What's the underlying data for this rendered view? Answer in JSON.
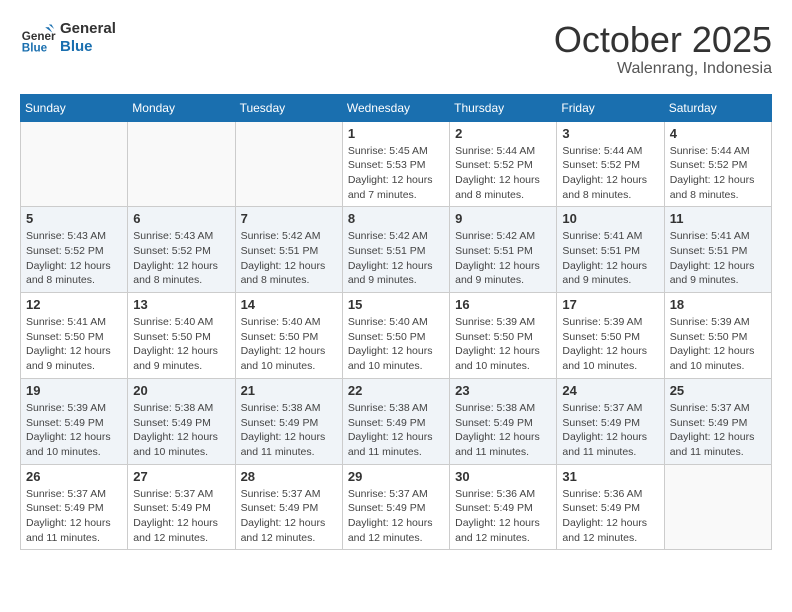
{
  "header": {
    "logo_line1": "General",
    "logo_line2": "Blue",
    "month": "October 2025",
    "location": "Walenrang, Indonesia"
  },
  "days_of_week": [
    "Sunday",
    "Monday",
    "Tuesday",
    "Wednesday",
    "Thursday",
    "Friday",
    "Saturday"
  ],
  "weeks": [
    [
      {
        "day": "",
        "info": ""
      },
      {
        "day": "",
        "info": ""
      },
      {
        "day": "",
        "info": ""
      },
      {
        "day": "1",
        "info": "Sunrise: 5:45 AM\nSunset: 5:53 PM\nDaylight: 12 hours\nand 7 minutes."
      },
      {
        "day": "2",
        "info": "Sunrise: 5:44 AM\nSunset: 5:52 PM\nDaylight: 12 hours\nand 8 minutes."
      },
      {
        "day": "3",
        "info": "Sunrise: 5:44 AM\nSunset: 5:52 PM\nDaylight: 12 hours\nand 8 minutes."
      },
      {
        "day": "4",
        "info": "Sunrise: 5:44 AM\nSunset: 5:52 PM\nDaylight: 12 hours\nand 8 minutes."
      }
    ],
    [
      {
        "day": "5",
        "info": "Sunrise: 5:43 AM\nSunset: 5:52 PM\nDaylight: 12 hours\nand 8 minutes."
      },
      {
        "day": "6",
        "info": "Sunrise: 5:43 AM\nSunset: 5:52 PM\nDaylight: 12 hours\nand 8 minutes."
      },
      {
        "day": "7",
        "info": "Sunrise: 5:42 AM\nSunset: 5:51 PM\nDaylight: 12 hours\nand 8 minutes."
      },
      {
        "day": "8",
        "info": "Sunrise: 5:42 AM\nSunset: 5:51 PM\nDaylight: 12 hours\nand 9 minutes."
      },
      {
        "day": "9",
        "info": "Sunrise: 5:42 AM\nSunset: 5:51 PM\nDaylight: 12 hours\nand 9 minutes."
      },
      {
        "day": "10",
        "info": "Sunrise: 5:41 AM\nSunset: 5:51 PM\nDaylight: 12 hours\nand 9 minutes."
      },
      {
        "day": "11",
        "info": "Sunrise: 5:41 AM\nSunset: 5:51 PM\nDaylight: 12 hours\nand 9 minutes."
      }
    ],
    [
      {
        "day": "12",
        "info": "Sunrise: 5:41 AM\nSunset: 5:50 PM\nDaylight: 12 hours\nand 9 minutes."
      },
      {
        "day": "13",
        "info": "Sunrise: 5:40 AM\nSunset: 5:50 PM\nDaylight: 12 hours\nand 9 minutes."
      },
      {
        "day": "14",
        "info": "Sunrise: 5:40 AM\nSunset: 5:50 PM\nDaylight: 12 hours\nand 10 minutes."
      },
      {
        "day": "15",
        "info": "Sunrise: 5:40 AM\nSunset: 5:50 PM\nDaylight: 12 hours\nand 10 minutes."
      },
      {
        "day": "16",
        "info": "Sunrise: 5:39 AM\nSunset: 5:50 PM\nDaylight: 12 hours\nand 10 minutes."
      },
      {
        "day": "17",
        "info": "Sunrise: 5:39 AM\nSunset: 5:50 PM\nDaylight: 12 hours\nand 10 minutes."
      },
      {
        "day": "18",
        "info": "Sunrise: 5:39 AM\nSunset: 5:50 PM\nDaylight: 12 hours\nand 10 minutes."
      }
    ],
    [
      {
        "day": "19",
        "info": "Sunrise: 5:39 AM\nSunset: 5:49 PM\nDaylight: 12 hours\nand 10 minutes."
      },
      {
        "day": "20",
        "info": "Sunrise: 5:38 AM\nSunset: 5:49 PM\nDaylight: 12 hours\nand 10 minutes."
      },
      {
        "day": "21",
        "info": "Sunrise: 5:38 AM\nSunset: 5:49 PM\nDaylight: 12 hours\nand 11 minutes."
      },
      {
        "day": "22",
        "info": "Sunrise: 5:38 AM\nSunset: 5:49 PM\nDaylight: 12 hours\nand 11 minutes."
      },
      {
        "day": "23",
        "info": "Sunrise: 5:38 AM\nSunset: 5:49 PM\nDaylight: 12 hours\nand 11 minutes."
      },
      {
        "day": "24",
        "info": "Sunrise: 5:37 AM\nSunset: 5:49 PM\nDaylight: 12 hours\nand 11 minutes."
      },
      {
        "day": "25",
        "info": "Sunrise: 5:37 AM\nSunset: 5:49 PM\nDaylight: 12 hours\nand 11 minutes."
      }
    ],
    [
      {
        "day": "26",
        "info": "Sunrise: 5:37 AM\nSunset: 5:49 PM\nDaylight: 12 hours\nand 11 minutes."
      },
      {
        "day": "27",
        "info": "Sunrise: 5:37 AM\nSunset: 5:49 PM\nDaylight: 12 hours\nand 12 minutes."
      },
      {
        "day": "28",
        "info": "Sunrise: 5:37 AM\nSunset: 5:49 PM\nDaylight: 12 hours\nand 12 minutes."
      },
      {
        "day": "29",
        "info": "Sunrise: 5:37 AM\nSunset: 5:49 PM\nDaylight: 12 hours\nand 12 minutes."
      },
      {
        "day": "30",
        "info": "Sunrise: 5:36 AM\nSunset: 5:49 PM\nDaylight: 12 hours\nand 12 minutes."
      },
      {
        "day": "31",
        "info": "Sunrise: 5:36 AM\nSunset: 5:49 PM\nDaylight: 12 hours\nand 12 minutes."
      },
      {
        "day": "",
        "info": ""
      }
    ]
  ]
}
